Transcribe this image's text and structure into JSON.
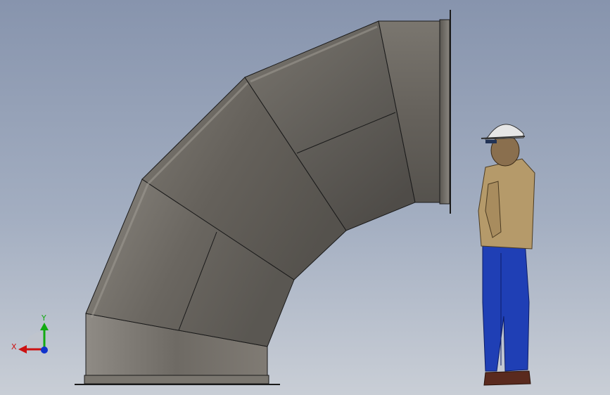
{
  "viewport": {
    "background_top": "#8794ad",
    "background_bottom": "#c9ced6"
  },
  "model": {
    "part": "elbow-duct",
    "segments": 5,
    "surface_color": "#6e6b66",
    "edge_color": "#1a1a1a"
  },
  "figure": {
    "part": "human-scale-figure",
    "helmet_color": "#e6e6e6",
    "shirt_color": "#b59a6a",
    "pants_color": "#1f3fb5",
    "shoes_color": "#5a2a1e"
  },
  "triad": {
    "x_label": "X",
    "y_label": "Y",
    "x_color": "#cc1111",
    "y_color": "#11aa11",
    "z_color": "#1133cc"
  }
}
